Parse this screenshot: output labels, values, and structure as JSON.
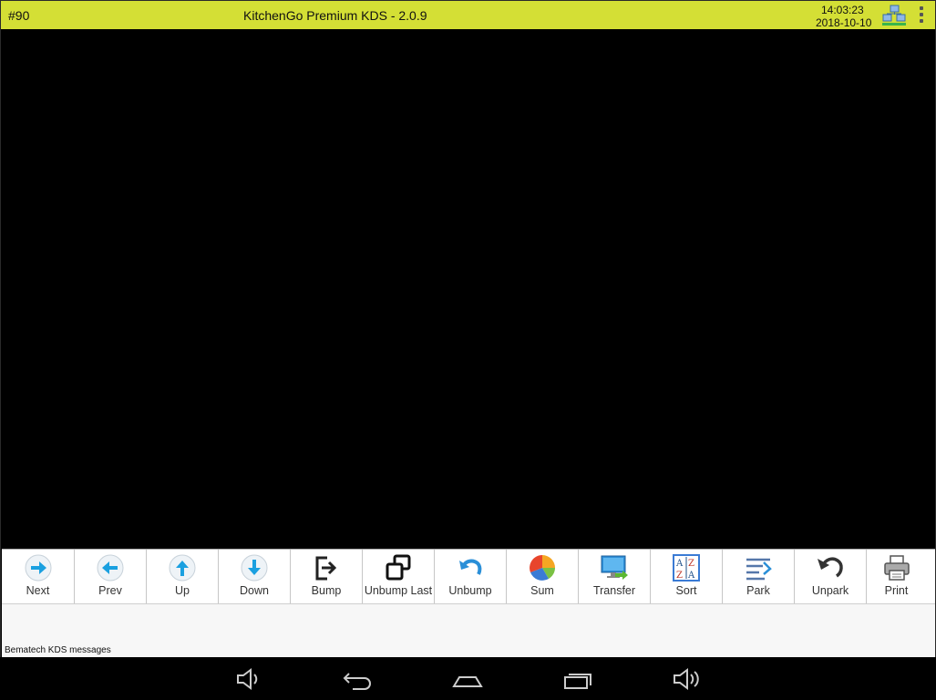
{
  "titlebar": {
    "station": "#90",
    "title": "KitchenGo Premium KDS - 2.0.9",
    "time": "14:03:23",
    "date": "2018-10-10",
    "background": "#d4df35"
  },
  "icons": {
    "network": "network-status-icon",
    "menu": "overflow-menu-icon"
  },
  "toolbar": {
    "buttons": [
      {
        "label": "Next",
        "icon": "arrow-right-icon"
      },
      {
        "label": "Prev",
        "icon": "arrow-left-icon"
      },
      {
        "label": "Up",
        "icon": "arrow-up-icon"
      },
      {
        "label": "Down",
        "icon": "arrow-down-icon"
      },
      {
        "label": "Bump",
        "icon": "bump-exit-icon"
      },
      {
        "label": "Unbump Last",
        "icon": "restore-windows-icon"
      },
      {
        "label": "Unbump",
        "icon": "undo-arrow-icon"
      },
      {
        "label": "Sum",
        "icon": "pie-chart-icon"
      },
      {
        "label": "Transfer",
        "icon": "monitor-transfer-icon"
      },
      {
        "label": "Sort",
        "icon": "sort-az-icon"
      },
      {
        "label": "Park",
        "icon": "park-lines-icon"
      },
      {
        "label": "Unpark",
        "icon": "rotate-back-icon"
      },
      {
        "label": "Print",
        "icon": "printer-icon"
      }
    ]
  },
  "messages": {
    "label": "Bematech KDS messages"
  },
  "android_nav": [
    "volume-down-icon",
    "back-icon",
    "home-icon",
    "recent-apps-icon",
    "volume-up-icon"
  ]
}
